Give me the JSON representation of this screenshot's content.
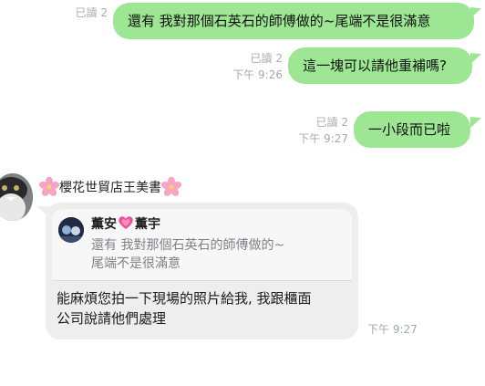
{
  "outgoing": [
    {
      "read": "已讀 2",
      "time": "",
      "text": "還有  我對那個石英石的師傅做的~尾端不是很滿意"
    },
    {
      "read": "已讀 2",
      "time": "下午 9:26",
      "text": "這一塊可以請他重補嗎?"
    },
    {
      "read": "已讀 2",
      "time": "下午 9:27",
      "text": "一小段而已啦"
    }
  ],
  "incoming": {
    "sender_name": "櫻花世貿店王美書",
    "sender_icon": "cherry-blossom",
    "quote": {
      "name_left": "薫安",
      "heart_icon": "pink-heart",
      "name_right": "薫宇",
      "line1": "還有  我對那個石英石的師傅做的~",
      "line2": "尾端不是很滿意"
    },
    "reply_line1": "能麻煩您拍一下現場的照片給我,  我跟櫃面",
    "reply_line2": "公司說請他們處理",
    "time": "下午 9:27"
  },
  "colors": {
    "outgoing_bubble": "#9de693",
    "incoming_bubble": "#eeeeee",
    "meta_text": "#a4a8ad"
  }
}
